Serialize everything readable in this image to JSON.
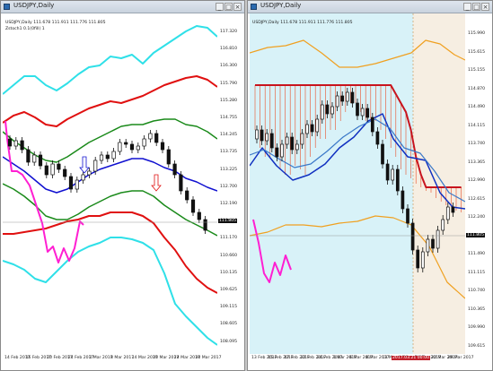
{
  "windows": {
    "left": {
      "title": "USDJPY,Daily"
    },
    "right": {
      "title": "USDJPY,Daily"
    }
  },
  "left_chart": {
    "info_line": "USDJPY,Daily  111.678 111.911 111.776 111.805",
    "indicator_label": "Zstoch1 0.1(0fill) 1",
    "price_box": "111.805",
    "y_ticks": [
      "117.320",
      "116.810",
      "116.300",
      "115.790",
      "115.280",
      "114.755",
      "114.245",
      "113.735",
      "113.225",
      "112.700",
      "112.190",
      "111.680",
      "111.170",
      "110.660",
      "110.135",
      "109.625",
      "109.115",
      "108.605",
      "108.095"
    ],
    "x_ticks": [
      "14 Feb 2017",
      "16 Feb 2017",
      "20 Feb 2017",
      "24 Feb 2017",
      "2 Mar 2017",
      "8 Mar 2017",
      "14 Mar 2017",
      "20 Mar 2017",
      "24 Mar 2017",
      "30 Mar 2017"
    ],
    "colors": {
      "upper3": "#2fe0e8",
      "upper2": "#e01010",
      "upper1": "#1a8a1a",
      "mid": "#1010d0",
      "lagging": "#ff1fd2",
      "candle": "#111111"
    }
  },
  "right_chart": {
    "info_line": "USDJPY,Daily  111.678 111.911 111.776 111.805",
    "price_box": "111.805",
    "cursor_label": "2017.03.21 00:00",
    "y_ticks": [
      "115.990",
      "115.615",
      "115.155",
      "114.870",
      "114.490",
      "114.115",
      "113.740",
      "113.365",
      "112.990",
      "112.615",
      "112.240",
      "111.865",
      "111.490",
      "111.115",
      "110.740",
      "110.365",
      "109.990",
      "109.615"
    ],
    "x_ticks": [
      "13 Feb 2017",
      "15 Feb 2017",
      "17 Feb 2017",
      "22 Feb 2017",
      "24 Feb 2017",
      "1 Mar 2017",
      "6 Mar 2017",
      "8 Mar 2017",
      "13 Mar 2017",
      "15 Mar 2017",
      "17 Mar 2017",
      "22 Mar 2017",
      "29 Mar 2017"
    ],
    "colors": {
      "bg": "#d8f2f8",
      "bg_right": "#f6eee2",
      "cloud_line": "#c8141e",
      "span_b": "#f0a020",
      "kijun": "#1030c0",
      "tenkan": "#3a78c8",
      "lagging": "#ff1fd2",
      "candle": "#111111"
    }
  }
}
